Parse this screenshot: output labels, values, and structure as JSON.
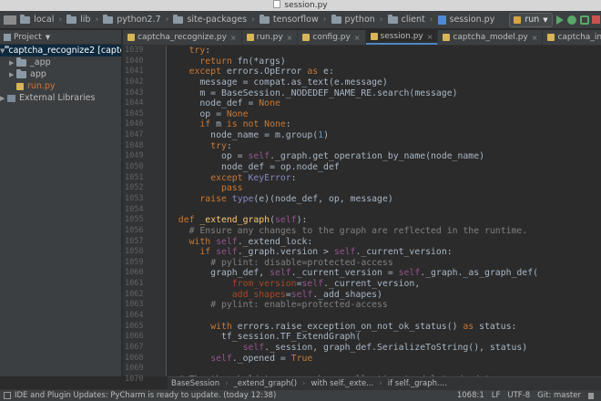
{
  "window": {
    "title": "session.py"
  },
  "navbar": {
    "crumbs": [
      "local",
      "lib",
      "python2.7",
      "site-packages",
      "tensorflow",
      "python",
      "client",
      "session.py"
    ],
    "run_config": "run"
  },
  "sidebar": {
    "header": "Project",
    "items": [
      {
        "label": "captcha_recognize2 [captc",
        "selected": true
      },
      {
        "label": "_app"
      },
      {
        "label": "app"
      },
      {
        "label": "run.py"
      },
      {
        "label": "External Libraries"
      }
    ]
  },
  "tabs": [
    {
      "label": "captcha_recognize.py"
    },
    {
      "label": "run.py"
    },
    {
      "label": "config.py"
    },
    {
      "label": "session.py",
      "active": true
    },
    {
      "label": "captcha_model.py"
    },
    {
      "label": "captcha_input.py"
    }
  ],
  "editor": {
    "line_numbers": [
      "1039",
      "1040",
      "1041",
      "1042",
      "1043",
      "1044",
      "1045",
      "1046",
      "1047",
      "1048",
      "1049",
      "1050",
      "1051",
      "1052",
      "1053",
      "1054",
      "1055",
      "1056",
      "1057",
      "1058",
      "1059",
      "1060",
      "1061",
      "1062",
      "1063",
      "1064",
      "1065",
      "1066",
      "1067",
      "1068",
      "1069",
      "1070"
    ]
  },
  "breadcrumb": [
    "BaseSession",
    "_extend_graph()",
    "with self._exte...",
    "if self._graph...."
  ],
  "status": {
    "message": "IDE and Plugin Updates: PyCharm is ready to update. (today 12:38)",
    "position": "1068:1",
    "line_sep": "LF",
    "encoding": "UTF-8",
    "vcs": "Git: master"
  },
  "colors": {
    "keyword": "#cc7832",
    "string": "#6a8759",
    "comment": "#808080",
    "self": "#94558d",
    "function": "#ffc66d",
    "number": "#6897bb",
    "accent": "#4a88c7"
  }
}
